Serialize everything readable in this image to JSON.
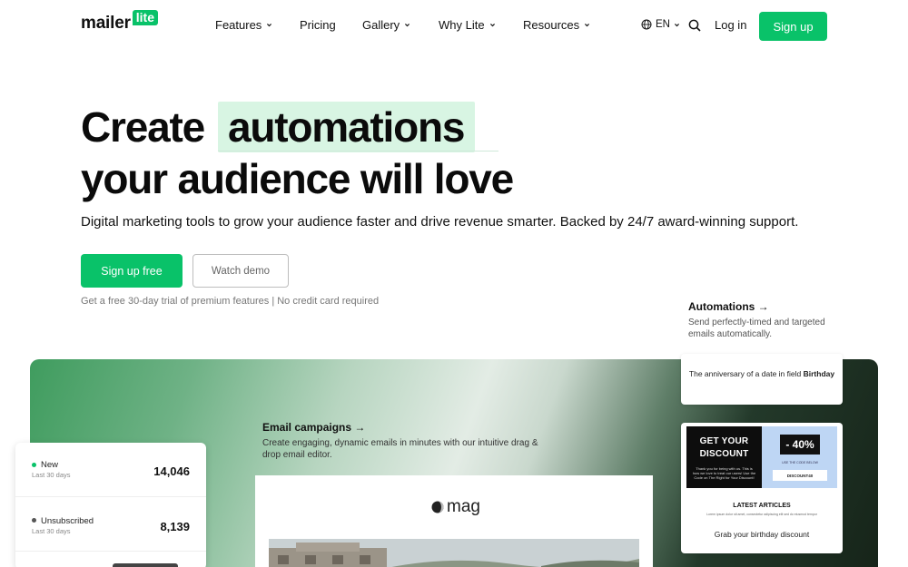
{
  "nav": {
    "logo_word": "mailer",
    "logo_badge": "lite",
    "items": [
      {
        "label": "Features",
        "dropdown": true
      },
      {
        "label": "Pricing",
        "dropdown": false
      },
      {
        "label": "Gallery",
        "dropdown": true
      },
      {
        "label": "Why Lite",
        "dropdown": true
      },
      {
        "label": "Resources",
        "dropdown": true
      }
    ],
    "language": "EN",
    "login": "Log in",
    "signup": "Sign up"
  },
  "hero": {
    "line1_prefix": "Create",
    "line1_highlight": "automations",
    "line2": "your audience will love",
    "subtitle": "Digital marketing tools to grow your audience faster and drive revenue smarter. Backed by 24/7 award-winning support.",
    "cta_primary": "Sign up free",
    "cta_secondary": "Watch demo",
    "trial_note": "Get a free 30-day trial of premium features | No credit card required"
  },
  "automations_feature": {
    "title": "Automations →",
    "description": "Send perfectly-timed and targeted emails automatically."
  },
  "email_feature": {
    "title": "Email campaigns →",
    "description": "Create engaging, dynamic emails in minutes with our intuitive drag & drop email editor.",
    "preview_brand": "mag"
  },
  "stats": [
    {
      "label": "New",
      "sub": "Last 30 days",
      "value": "14,046",
      "dot_color": "#09c269"
    },
    {
      "label": "Unsubscribed",
      "sub": "Last 30 days",
      "value": "8,139",
      "dot_color": "#555555"
    }
  ],
  "automation_cards": {
    "trigger_text": "The anniversary of a date in field",
    "trigger_field": "Birthday",
    "promo_headline_1": "GET YOUR",
    "promo_headline_2": "DISCOUNT",
    "promo_small": "Thank you for being with us. This is how we love to treat our users! Use the Code on The Right for Your Discount!",
    "promo_percent": "- 40%",
    "promo_code_note": "USE THE CODE BELOW",
    "promo_code": "DISCOUNT40",
    "latest_title": "LATEST ARTICLES",
    "latest_sub": "Lorem ipsum dolor sit amet, consectetur adipiscing elit sed do eiusmod tempor",
    "caption": "Grab your birthday discount"
  },
  "colors": {
    "brand_green": "#09c269",
    "highlight": "#d8f5e3"
  }
}
